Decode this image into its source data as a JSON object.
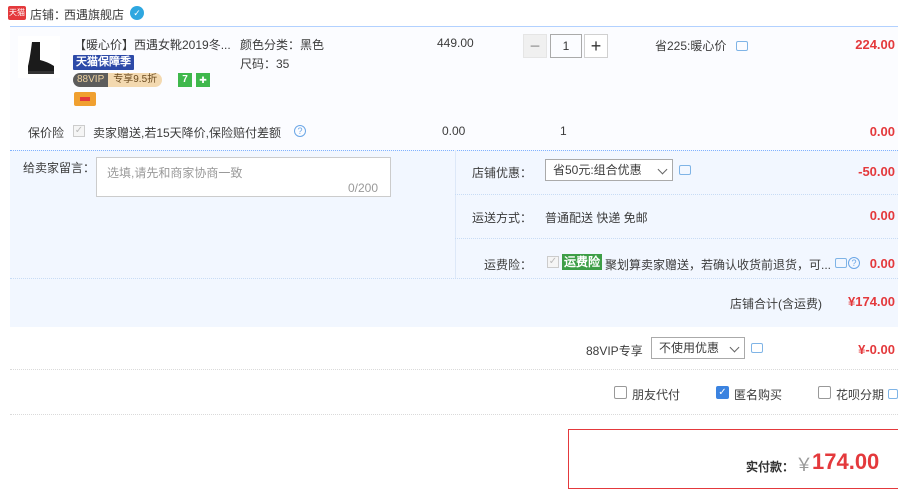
{
  "shop": {
    "logo_text": "天猫",
    "label": "店铺：",
    "name": "西遇旗舰店",
    "wangwang_icon": "ww-icon"
  },
  "item": {
    "title": "【暖心价】西遇女靴2019冬...",
    "tmall_tag": "天猫保障季",
    "vip_tag_a": "88VIP",
    "vip_tag_b": "专享9.5折",
    "green_tag": "7",
    "sku_color": "颜色分类：黑色",
    "sku_size": "尺码：35",
    "price": "449.00",
    "quantity": "1",
    "discount_text": "省225:暖心价",
    "subtotal": "224.00"
  },
  "insurance": {
    "label": "保价险",
    "text": "卖家赠送,若15天降价,保险赔付差额",
    "price": "0.00",
    "qty": "1",
    "total": "0.00"
  },
  "message": {
    "label": "给卖家留言：",
    "placeholder": "选填,请先和商家协商一致",
    "count": "0/200"
  },
  "shop_discount": {
    "label": "店铺优惠：",
    "selected": "省50元:组合优惠",
    "value": "-50.00"
  },
  "shipping": {
    "label": "运送方式：",
    "value": "普通配送 快递 免邮",
    "price": "0.00"
  },
  "return_insurance": {
    "label": "运费险：",
    "tag": "运费险",
    "text": "聚划算卖家赠送，若确认收货前退货，可...",
    "price": "0.00"
  },
  "shop_total": {
    "label": "店铺合计(含运费)",
    "value": "¥174.00"
  },
  "vip": {
    "label": "88VIP专享",
    "selected": "不使用优惠",
    "value": "¥-0.00"
  },
  "options": {
    "friend_pay": "朋友代付",
    "anonymous": "匿名购买",
    "huabei": "花呗分期"
  },
  "payment": {
    "label": "实付款：",
    "yen": "￥",
    "value": "174.00"
  },
  "colors": {
    "accent": "#e4393c",
    "blue": "#3b83e0",
    "block_bg": "#f2f7ff"
  }
}
